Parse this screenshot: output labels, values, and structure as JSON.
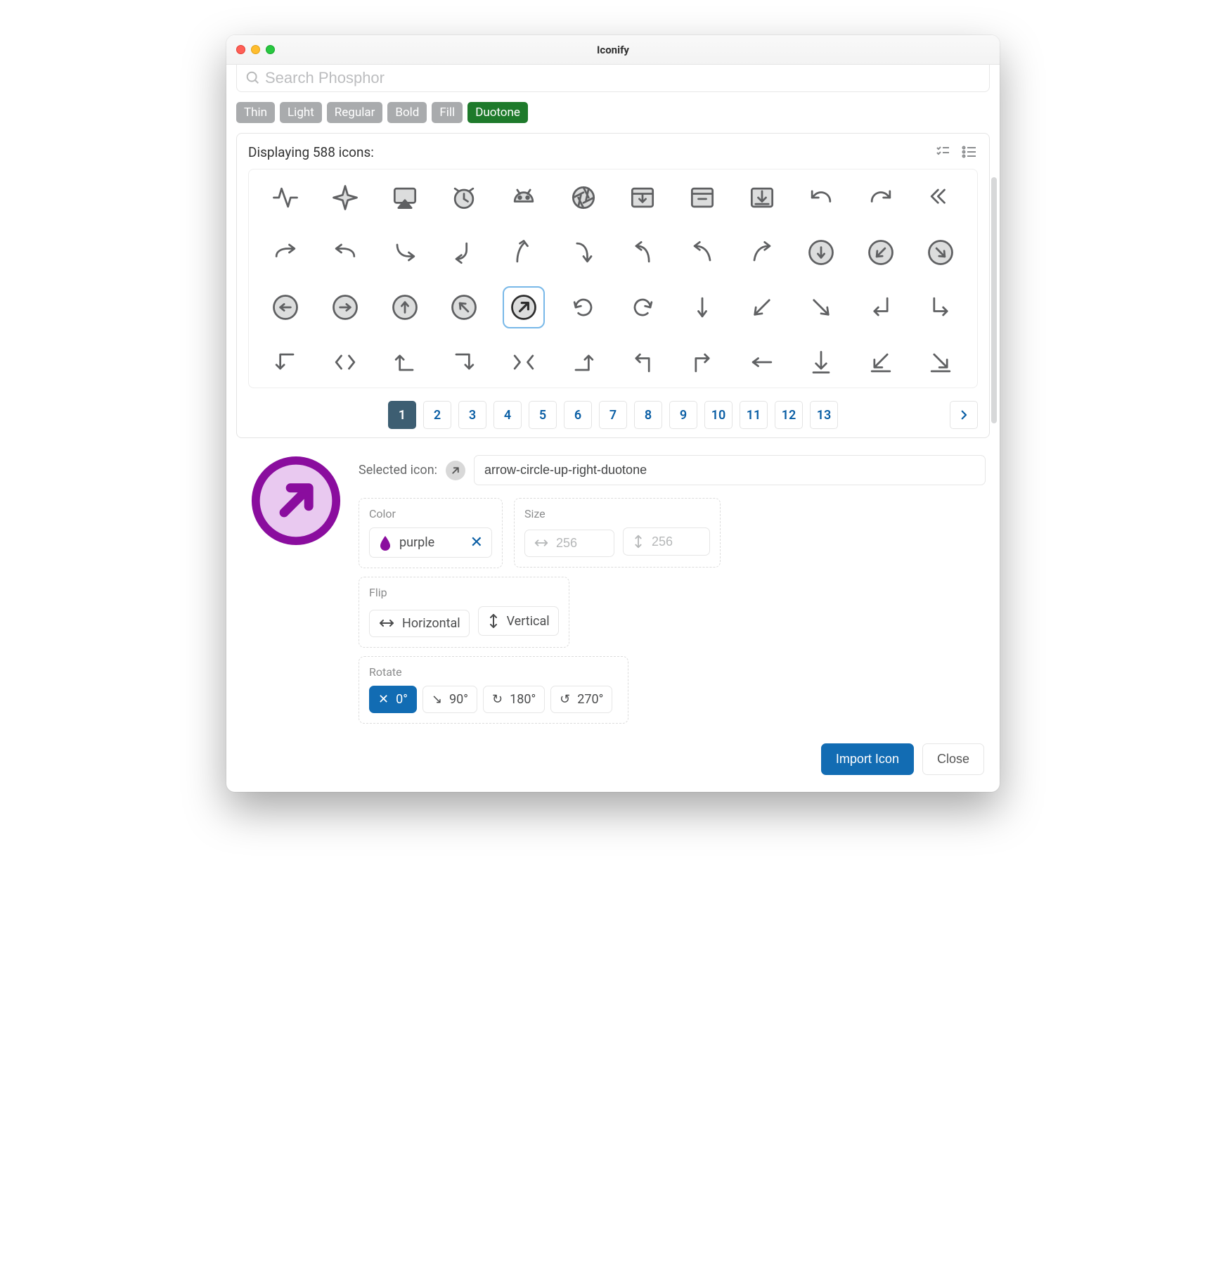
{
  "window": {
    "title": "Iconify"
  },
  "search": {
    "placeholder": "Search Phosphor"
  },
  "filters": {
    "items": [
      "Thin",
      "Light",
      "Regular",
      "Bold",
      "Fill",
      "Duotone"
    ],
    "active_index": 5
  },
  "panel": {
    "count_text": "Displaying 588 icons:",
    "icons": [
      "activity",
      "airplane",
      "airplay",
      "alarm",
      "android-logo",
      "aperture",
      "archive-tray",
      "archive-box",
      "download-box",
      "undo",
      "redo",
      "reply-all",
      "bend-right",
      "bend-left",
      "bend-down-right",
      "corner-down-left",
      "corner-up",
      "corner-down",
      "curve-up-left",
      "curve-up-left-2",
      "curve-up-right",
      "arrow-circle-down",
      "arrow-circle-down-left",
      "arrow-circle-down-right",
      "arrow-circle-left",
      "arrow-circle-right",
      "arrow-circle-up",
      "arrow-circle-up-left",
      "arrow-circle-up-right",
      "rotate-cw",
      "rotate-ccw",
      "arrow-down",
      "arrow-down-left",
      "arrow-down-right",
      "elbow-down-left",
      "elbow-down-right",
      "elbow-left-down",
      "chevrons-out",
      "elbow-left-up",
      "elbow-right-down",
      "chevrons-in",
      "elbow-right-up",
      "elbow-up-left",
      "elbow-up-right",
      "arrow-left",
      "line-down",
      "line-down-left",
      "line-down-right"
    ],
    "selected_index": 28
  },
  "pager": {
    "pages": [
      "1",
      "2",
      "3",
      "4",
      "5",
      "6",
      "7",
      "8",
      "9",
      "10",
      "11",
      "12",
      "13"
    ],
    "current": "1"
  },
  "selected": {
    "label": "Selected icon:",
    "name": "arrow-circle-up-right-duotone"
  },
  "color": {
    "title": "Color",
    "value": "purple",
    "hex": "#8a0d9e"
  },
  "size": {
    "title": "Size",
    "width_placeholder": "256",
    "height_placeholder": "256"
  },
  "flip": {
    "title": "Flip",
    "horizontal": "Horizontal",
    "vertical": "Vertical"
  },
  "rotate": {
    "title": "Rotate",
    "options": [
      "0°",
      "90°",
      "180°",
      "270°"
    ],
    "active_index": 0
  },
  "footer": {
    "import": "Import Icon",
    "close": "Close"
  }
}
